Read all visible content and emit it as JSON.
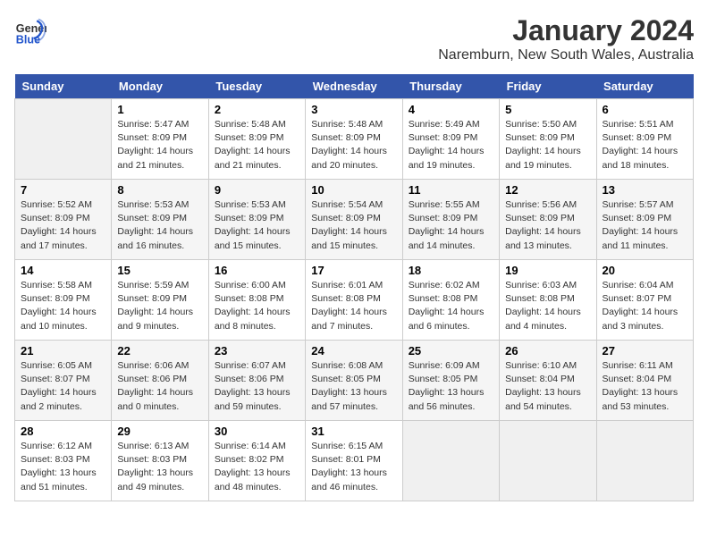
{
  "header": {
    "logo_line1": "General",
    "logo_line2": "Blue",
    "title": "January 2024",
    "subtitle": "Naremburn, New South Wales, Australia"
  },
  "columns": [
    "Sunday",
    "Monday",
    "Tuesday",
    "Wednesday",
    "Thursday",
    "Friday",
    "Saturday"
  ],
  "weeks": [
    [
      {
        "day": "",
        "empty": true
      },
      {
        "day": "1",
        "sunrise": "5:47 AM",
        "sunset": "8:09 PM",
        "daylight": "14 hours and 21 minutes."
      },
      {
        "day": "2",
        "sunrise": "5:48 AM",
        "sunset": "8:09 PM",
        "daylight": "14 hours and 21 minutes."
      },
      {
        "day": "3",
        "sunrise": "5:48 AM",
        "sunset": "8:09 PM",
        "daylight": "14 hours and 20 minutes."
      },
      {
        "day": "4",
        "sunrise": "5:49 AM",
        "sunset": "8:09 PM",
        "daylight": "14 hours and 19 minutes."
      },
      {
        "day": "5",
        "sunrise": "5:50 AM",
        "sunset": "8:09 PM",
        "daylight": "14 hours and 19 minutes."
      },
      {
        "day": "6",
        "sunrise": "5:51 AM",
        "sunset": "8:09 PM",
        "daylight": "14 hours and 18 minutes."
      }
    ],
    [
      {
        "day": "7",
        "sunrise": "5:52 AM",
        "sunset": "8:09 PM",
        "daylight": "14 hours and 17 minutes."
      },
      {
        "day": "8",
        "sunrise": "5:53 AM",
        "sunset": "8:09 PM",
        "daylight": "14 hours and 16 minutes."
      },
      {
        "day": "9",
        "sunrise": "5:53 AM",
        "sunset": "8:09 PM",
        "daylight": "14 hours and 15 minutes."
      },
      {
        "day": "10",
        "sunrise": "5:54 AM",
        "sunset": "8:09 PM",
        "daylight": "14 hours and 15 minutes."
      },
      {
        "day": "11",
        "sunrise": "5:55 AM",
        "sunset": "8:09 PM",
        "daylight": "14 hours and 14 minutes."
      },
      {
        "day": "12",
        "sunrise": "5:56 AM",
        "sunset": "8:09 PM",
        "daylight": "14 hours and 13 minutes."
      },
      {
        "day": "13",
        "sunrise": "5:57 AM",
        "sunset": "8:09 PM",
        "daylight": "14 hours and 11 minutes."
      }
    ],
    [
      {
        "day": "14",
        "sunrise": "5:58 AM",
        "sunset": "8:09 PM",
        "daylight": "14 hours and 10 minutes."
      },
      {
        "day": "15",
        "sunrise": "5:59 AM",
        "sunset": "8:09 PM",
        "daylight": "14 hours and 9 minutes."
      },
      {
        "day": "16",
        "sunrise": "6:00 AM",
        "sunset": "8:08 PM",
        "daylight": "14 hours and 8 minutes."
      },
      {
        "day": "17",
        "sunrise": "6:01 AM",
        "sunset": "8:08 PM",
        "daylight": "14 hours and 7 minutes."
      },
      {
        "day": "18",
        "sunrise": "6:02 AM",
        "sunset": "8:08 PM",
        "daylight": "14 hours and 6 minutes."
      },
      {
        "day": "19",
        "sunrise": "6:03 AM",
        "sunset": "8:08 PM",
        "daylight": "14 hours and 4 minutes."
      },
      {
        "day": "20",
        "sunrise": "6:04 AM",
        "sunset": "8:07 PM",
        "daylight": "14 hours and 3 minutes."
      }
    ],
    [
      {
        "day": "21",
        "sunrise": "6:05 AM",
        "sunset": "8:07 PM",
        "daylight": "14 hours and 2 minutes."
      },
      {
        "day": "22",
        "sunrise": "6:06 AM",
        "sunset": "8:06 PM",
        "daylight": "14 hours and 0 minutes."
      },
      {
        "day": "23",
        "sunrise": "6:07 AM",
        "sunset": "8:06 PM",
        "daylight": "13 hours and 59 minutes."
      },
      {
        "day": "24",
        "sunrise": "6:08 AM",
        "sunset": "8:05 PM",
        "daylight": "13 hours and 57 minutes."
      },
      {
        "day": "25",
        "sunrise": "6:09 AM",
        "sunset": "8:05 PM",
        "daylight": "13 hours and 56 minutes."
      },
      {
        "day": "26",
        "sunrise": "6:10 AM",
        "sunset": "8:04 PM",
        "daylight": "13 hours and 54 minutes."
      },
      {
        "day": "27",
        "sunrise": "6:11 AM",
        "sunset": "8:04 PM",
        "daylight": "13 hours and 53 minutes."
      }
    ],
    [
      {
        "day": "28",
        "sunrise": "6:12 AM",
        "sunset": "8:03 PM",
        "daylight": "13 hours and 51 minutes."
      },
      {
        "day": "29",
        "sunrise": "6:13 AM",
        "sunset": "8:03 PM",
        "daylight": "13 hours and 49 minutes."
      },
      {
        "day": "30",
        "sunrise": "6:14 AM",
        "sunset": "8:02 PM",
        "daylight": "13 hours and 48 minutes."
      },
      {
        "day": "31",
        "sunrise": "6:15 AM",
        "sunset": "8:01 PM",
        "daylight": "13 hours and 46 minutes."
      },
      {
        "day": "",
        "empty": true
      },
      {
        "day": "",
        "empty": true
      },
      {
        "day": "",
        "empty": true
      }
    ]
  ]
}
